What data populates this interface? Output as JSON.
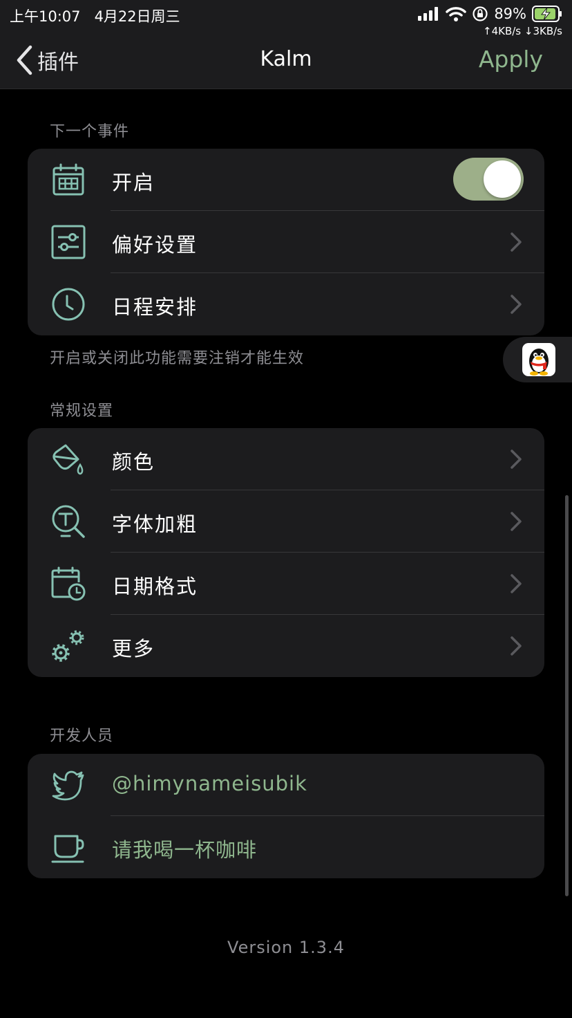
{
  "status_bar": {
    "time": "上午10:07",
    "date": "4月22日周三",
    "battery": "89%",
    "net_speed": "↑4KB/s ↓3KB/s"
  },
  "nav": {
    "back_label": "插件",
    "title": "Kalm",
    "apply_label": "Apply"
  },
  "sections": {
    "next_event": {
      "header": "下一个事件",
      "items": [
        {
          "label": "开启",
          "icon": "calendar-grid-icon"
        },
        {
          "label": "偏好设置",
          "icon": "sliders-icon"
        },
        {
          "label": "日程安排",
          "icon": "clock-icon"
        }
      ],
      "toggle_on": true,
      "footer": "开启或关闭此功能需要注销才能生效"
    },
    "general": {
      "header": "常规设置",
      "items": [
        {
          "label": "颜色",
          "icon": "paint-bucket-icon"
        },
        {
          "label": "字体加粗",
          "icon": "font-search-icon"
        },
        {
          "label": "日期格式",
          "icon": "calendar-clock-icon"
        },
        {
          "label": "更多",
          "icon": "gears-icon"
        }
      ]
    },
    "developer": {
      "header": "开发人员",
      "items": [
        {
          "label": "@himynameisubik",
          "icon": "twitter-icon"
        },
        {
          "label": "请我喝一杯咖啡",
          "icon": "coffee-cup-icon"
        }
      ]
    }
  },
  "version": "Version 1.3.4",
  "colors": {
    "accent": "#8fb78e",
    "toggle_on": "#9daf89",
    "icon": "#86c1b2",
    "background": "#000000",
    "cell": "#1c1c1e"
  }
}
